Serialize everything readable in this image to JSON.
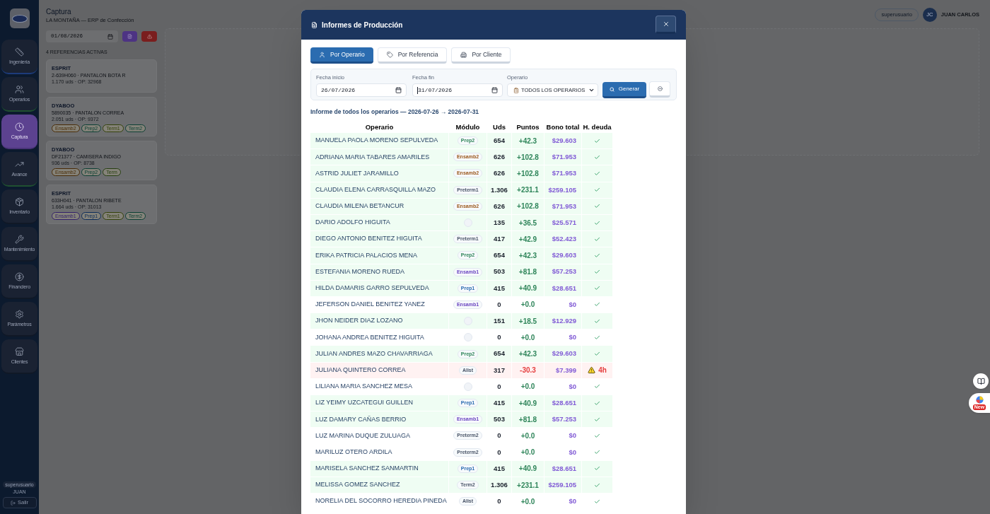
{
  "sidebar": {
    "items": [
      {
        "label": "Ingeniería",
        "selected": false,
        "color": "#1d3b7a"
      },
      {
        "label": "Operarios",
        "selected": false,
        "color": "#1f5030"
      },
      {
        "label": "Captura",
        "selected": true
      },
      {
        "label": "Avance",
        "selected": false,
        "color": "#1f5030"
      },
      {
        "label": "Inventario",
        "selected": false
      },
      {
        "label": "Mantenimiento",
        "selected": false
      },
      {
        "label": "Financiero",
        "selected": false
      },
      {
        "label": "Parámetros",
        "selected": false
      },
      {
        "label": "Clientes",
        "selected": false
      }
    ],
    "user_role": "superusuario",
    "user_name": "JUAN",
    "logout": "Salir"
  },
  "header": {
    "title": "Captura",
    "subtitle": "LA MONTAÑA — ERP de Confección",
    "role": "superusuario",
    "avatar": "JC",
    "user": "JUAN CARLOS"
  },
  "captura_panel": {
    "date": "01/08/2026",
    "count_label": "4 REFERENCIAS ACTIVAS",
    "references": [
      {
        "client": "ESPRIT",
        "product": "2-639H060 · PANTALON BOTA R",
        "meta": "1.170 uds · OP: 32968"
      },
      {
        "client": "DYABOO",
        "product": "5890035 · PANTALON CORREA",
        "meta": "2.051 uds · OP: 9372",
        "modules": [
          {
            "label": "Ensamb2",
            "color": "#4a2c06"
          },
          {
            "label": "Prep2",
            "color": "#0c4034"
          },
          {
            "label": "Term1",
            "color": "#34420a"
          },
          {
            "label": "Term2",
            "color": "#0c4034"
          }
        ]
      },
      {
        "client": "DYABOO",
        "product": "DF21377 · CAMISERA INDIGO",
        "meta": "936 uds · OP: 8738",
        "modules": [
          {
            "label": "Ensamb2",
            "color": "#4a2c06"
          },
          {
            "label": "Prep2",
            "color": "#0c4034"
          },
          {
            "label": "Term",
            "color": "#263f10"
          }
        ]
      },
      {
        "client": "ESPRIT",
        "product": "633H041 · PANTALON RIBETE",
        "meta": "1.664 uds · OP: 31013",
        "modules": [
          {
            "label": "Ensamb1",
            "color": "#33206a"
          },
          {
            "label": "Prep1",
            "color": "#0c2c5a"
          },
          {
            "label": "Term1",
            "color": "#34420a"
          },
          {
            "label": "Term2",
            "color": "#0c4034"
          }
        ]
      }
    ]
  },
  "modal": {
    "title": "Informes de Producción",
    "tabs": [
      {
        "label": "Por Operario",
        "selected": true
      },
      {
        "label": "Por Referencia",
        "selected": false
      },
      {
        "label": "Por Cliente",
        "selected": false
      }
    ],
    "filters": {
      "start_label": "Fecha inicio",
      "start_value": "26/07/2026",
      "start_focused": false,
      "end_label": "Fecha fin",
      "end_value": "31/07/2026",
      "end_focused": true,
      "operator_label": "Operario",
      "operator_value": "TODOS LOS OPERARIOS",
      "generate": "Generar"
    },
    "summary": "Informe de todos los operarios — 2026-07-26 → 2026-07-31",
    "table": {
      "columns": [
        "Operario",
        "Módulo",
        "Uds",
        "Puntos",
        "Bono total",
        "H. deuda"
      ],
      "rows": [
        {
          "kind": "bonus",
          "name": "MANUELA PAOLA MORENO SEPULVEDA",
          "module": {
            "label": "Prep2",
            "color": "#2f855a"
          },
          "units": "654",
          "points": "+42.3",
          "bonus": "$29.603"
        },
        {
          "kind": "bonus",
          "name": "ADRIANA MARIA TABARES AMARILES",
          "module": {
            "label": "Ensamb2",
            "color": "#9c5a1e"
          },
          "units": "626",
          "points": "+102.8",
          "bonus": "$71.953"
        },
        {
          "kind": "bonus",
          "name": "ASTRID JULIET JARAMILLO",
          "module": {
            "label": "Ensamb2",
            "color": "#9c5a1e"
          },
          "units": "626",
          "points": "+102.8",
          "bonus": "$71.953"
        },
        {
          "kind": "bonus",
          "name": "CLAUDIA ELENA CARRASQUILLA MAZO",
          "module": {
            "label": "Preterm1",
            "color": "#4a5568"
          },
          "units": "1.306",
          "points": "+231.1",
          "bonus": "$259.105"
        },
        {
          "kind": "bonus",
          "name": "CLAUDIA MILENA BETANCUR",
          "module": {
            "label": "Ensamb2",
            "color": "#9c5a1e"
          },
          "units": "626",
          "points": "+102.8",
          "bonus": "$71.953"
        },
        {
          "kind": "bonus",
          "name": "DARIO ADOLFO HIGUITA",
          "units": "135",
          "points": "+36.5",
          "bonus": "$25.571"
        },
        {
          "kind": "bonus",
          "name": "DIEGO ANTONIO BENITEZ HIGUITA",
          "module": {
            "label": "Preterm1",
            "color": "#4a5568"
          },
          "units": "417",
          "points": "+42.9",
          "bonus": "$52.423"
        },
        {
          "kind": "bonus",
          "name": "ERIKA PATRICIA PALACIOS MENA",
          "module": {
            "label": "Prep2",
            "color": "#2f855a"
          },
          "units": "654",
          "points": "+42.3",
          "bonus": "$29.603"
        },
        {
          "kind": "bonus",
          "name": "ESTEFANIA MORENO RUEDA",
          "module": {
            "label": "Ensamb1",
            "color": "#6b46c1"
          },
          "units": "503",
          "points": "+81.8",
          "bonus": "$57.253"
        },
        {
          "kind": "bonus",
          "name": "HILDA DAMARIS GARRO SEPULVEDA",
          "module": {
            "label": "Prep1",
            "color": "#2b6cb0"
          },
          "units": "415",
          "points": "+40.9",
          "bonus": "$28.651"
        },
        {
          "kind": "zero",
          "name": "JEFERSON DANIEL BENITEZ YANEZ",
          "module": {
            "label": "Ensamb1",
            "color": "#6b46c1"
          },
          "units": "0",
          "points": "+0.0",
          "bonus": "$0"
        },
        {
          "kind": "bonus",
          "name": "JHON NEIDER DIAZ LOZANO",
          "units": "151",
          "points": "+18.5",
          "bonus": "$12.929"
        },
        {
          "kind": "zero",
          "name": "JOHANA ANDREA BENITEZ HIGUITA",
          "units": "0",
          "points": "+0.0",
          "bonus": "$0"
        },
        {
          "kind": "bonus",
          "name": "JULIAN ANDRES MAZO CHAVARRIAGA",
          "module": {
            "label": "Prep2",
            "color": "#2f855a"
          },
          "units": "654",
          "points": "+42.3",
          "bonus": "$29.603"
        },
        {
          "kind": "debt",
          "name": "JULIANA QUINTERO CORREA",
          "module": {
            "label": "Alist",
            "color": "#4a5568"
          },
          "units": "317",
          "points": "-30.3",
          "bonus": "$7.399",
          "debt_hours": "4h"
        },
        {
          "kind": "zero",
          "name": "LILIANA MARIA SANCHEZ MESA",
          "units": "0",
          "points": "+0.0",
          "bonus": "$0"
        },
        {
          "kind": "bonus",
          "name": "LIZ YEIMY UZCATEGUI GUILLEN",
          "module": {
            "label": "Prep1",
            "color": "#2b6cb0"
          },
          "units": "415",
          "points": "+40.9",
          "bonus": "$28.651"
        },
        {
          "kind": "bonus",
          "name": "LUZ DAMARY CAÑAS BERRIO",
          "module": {
            "label": "Ensamb1",
            "color": "#6b46c1"
          },
          "units": "503",
          "points": "+81.8",
          "bonus": "$57.253"
        },
        {
          "kind": "zero",
          "name": "LUZ MARINA DUQUE ZULUAGA",
          "module": {
            "label": "Preterm2",
            "color": "#4a5568"
          },
          "units": "0",
          "points": "+0.0",
          "bonus": "$0"
        },
        {
          "kind": "zero",
          "name": "MARILUZ OTERO ARDILA",
          "module": {
            "label": "Preterm2",
            "color": "#4a5568"
          },
          "units": "0",
          "points": "+0.0",
          "bonus": "$0"
        },
        {
          "kind": "bonus",
          "name": "MARISELA SANCHEZ SANMARTIN",
          "module": {
            "label": "Prep1",
            "color": "#2b6cb0"
          },
          "units": "415",
          "points": "+40.9",
          "bonus": "$28.651"
        },
        {
          "kind": "bonus",
          "name": "MELISSA GOMEZ SANCHEZ",
          "module": {
            "label": "Term2",
            "color": "#4a5568"
          },
          "units": "1.306",
          "points": "+231.1",
          "bonus": "$259.105"
        },
        {
          "kind": "zero",
          "name": "NORELIA DEL SOCORRO HEREDIA PINEDA",
          "module": {
            "label": "Alist",
            "color": "#4a5568"
          },
          "units": "0",
          "points": "+0.0",
          "bonus": "$0"
        }
      ]
    }
  },
  "floating": {
    "badge": "New"
  }
}
